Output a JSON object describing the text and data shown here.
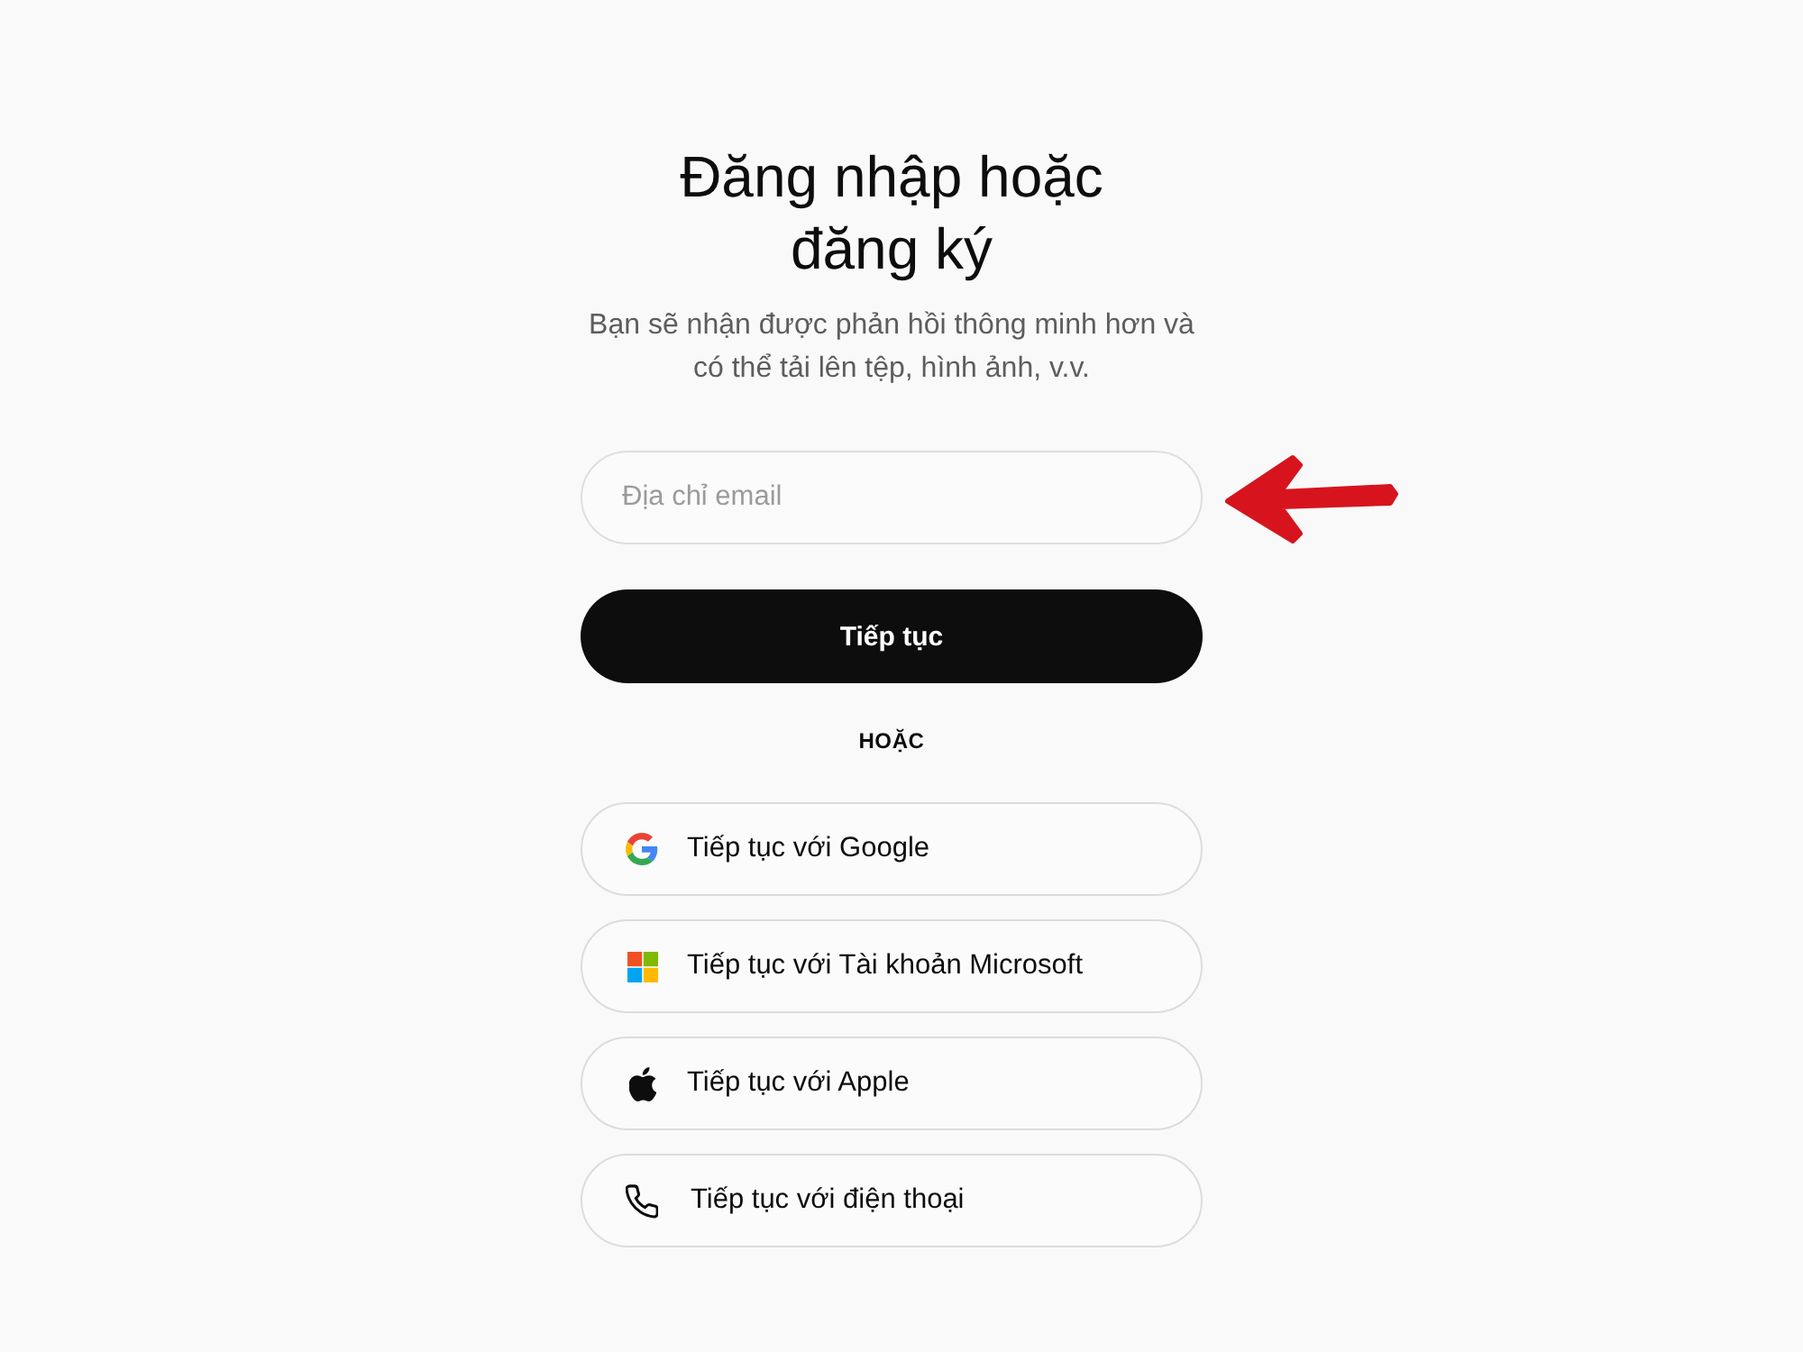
{
  "heading": "Đăng nhập hoặc đăng ký",
  "subtitle": "Bạn sẽ nhận được phản hồi thông minh hơn và có thể tải lên tệp, hình ảnh, v.v.",
  "email_field": {
    "placeholder": "Địa chỉ email"
  },
  "continue_button": "Tiếp tục",
  "divider": "HOẶC",
  "providers": [
    {
      "kind": "google",
      "label": "Tiếp tục với Google"
    },
    {
      "kind": "microsoft",
      "label": "Tiếp tục với Tài khoản Microsoft"
    },
    {
      "kind": "apple",
      "label": "Tiếp tục với Apple"
    },
    {
      "kind": "phone",
      "label": "Tiếp tục với điện thoại"
    }
  ]
}
